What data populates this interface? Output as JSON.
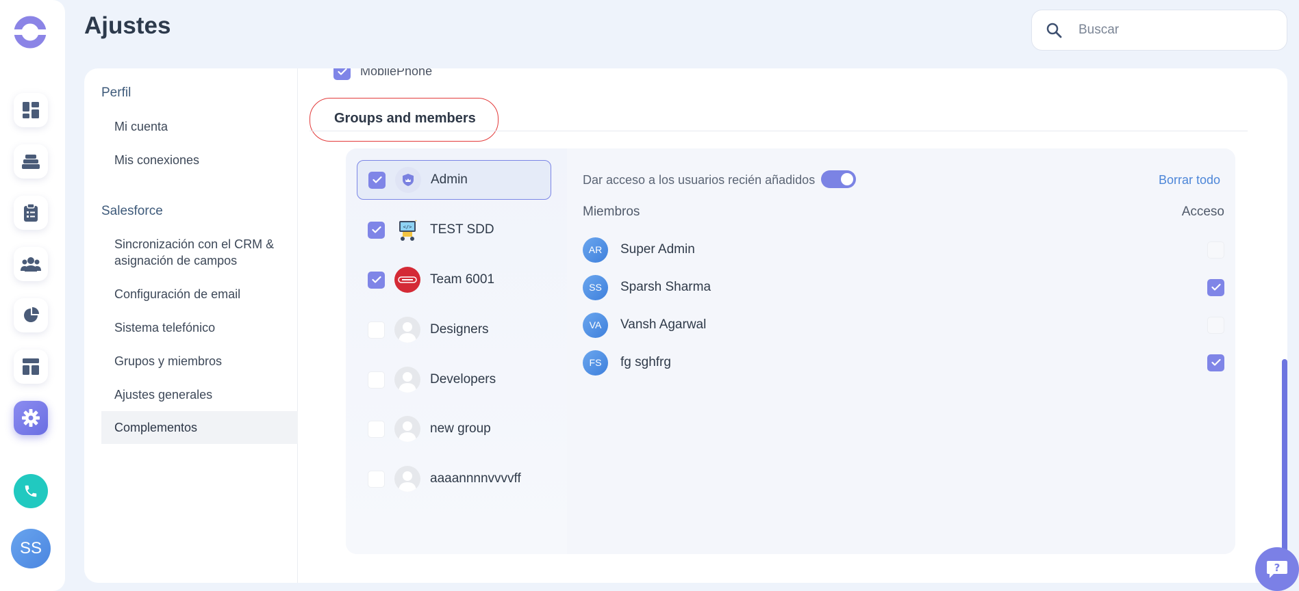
{
  "header": {
    "title": "Ajustes"
  },
  "search": {
    "placeholder": "Buscar",
    "value": ""
  },
  "rail": {
    "icons": [
      "dashboard-icon",
      "layers-icon",
      "clipboard-icon",
      "team-icon",
      "pie-chart-icon",
      "layout-icon",
      "gear-icon"
    ],
    "active": "gear-icon",
    "avatar_initials": "SS"
  },
  "nav": {
    "profile_section": "Perfil",
    "profile_items": [
      "Mi cuenta",
      "Mis conexiones"
    ],
    "salesforce_section": "Salesforce",
    "salesforce_items": [
      "Sincronización con el CRM & asignación de campos",
      "Configuración de email",
      "Sistema telefónico",
      "Grupos y miembros",
      "Ajustes generales",
      "Complementos"
    ],
    "active_item": "Complementos"
  },
  "content": {
    "top_checkbox_label": "MobilePhone",
    "section_title": "Groups and members",
    "access_label": "Dar acceso a los usuarios recién añadidos",
    "access_toggle_on": true,
    "clear_all": "Borrar todo",
    "members_header": "Miembros",
    "access_header": "Acceso"
  },
  "groups": [
    {
      "name": "Admin",
      "checked": true,
      "selected": true,
      "avatar": "shield-avatar"
    },
    {
      "name": "TEST SDD",
      "checked": true,
      "selected": false,
      "avatar": "robot-avatar"
    },
    {
      "name": "Team 6001",
      "checked": true,
      "selected": false,
      "avatar": "red-logo-avatar"
    },
    {
      "name": "Designers",
      "checked": false,
      "selected": false,
      "avatar": "default-avatar"
    },
    {
      "name": "Developers",
      "checked": false,
      "selected": false,
      "avatar": "default-avatar"
    },
    {
      "name": "new group",
      "checked": false,
      "selected": false,
      "avatar": "default-avatar"
    },
    {
      "name": "aaaannnnvvvvff",
      "checked": false,
      "selected": false,
      "avatar": "default-avatar"
    }
  ],
  "members": [
    {
      "initials": "AR",
      "name": "Super Admin",
      "access": false
    },
    {
      "initials": "SS",
      "name": "Sparsh Sharma",
      "access": true
    },
    {
      "initials": "VA",
      "name": "Vansh Agarwal",
      "access": false
    },
    {
      "initials": "FS",
      "name": "fg sghfrg",
      "access": true
    }
  ],
  "colors": {
    "accent": "#7f85e7",
    "link": "#4c86d8",
    "highlight_border": "#e23a3a",
    "phone": "#21c9c0"
  }
}
